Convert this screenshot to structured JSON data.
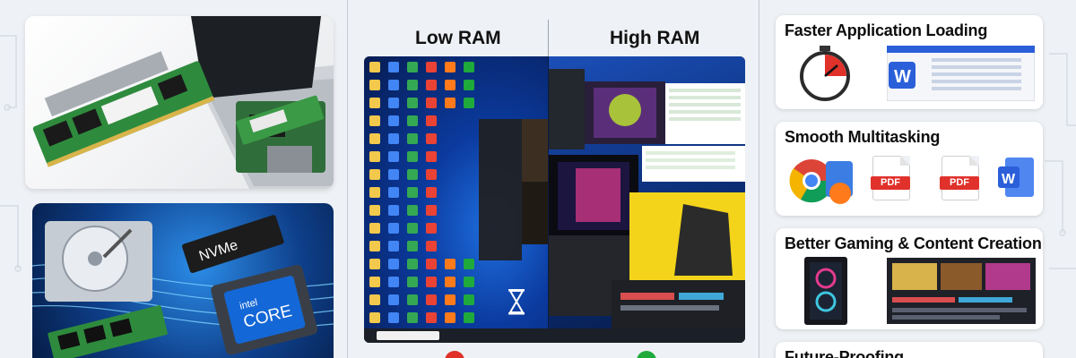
{
  "comparison": {
    "low_label": "Low RAM",
    "high_label": "High RAM"
  },
  "benefits": [
    {
      "title": "Faster Application Loading"
    },
    {
      "title": "Smooth Multitasking"
    },
    {
      "title": "Better Gaming & Content Creation"
    },
    {
      "title": "Future-Proofing"
    }
  ],
  "hardware": {
    "ssd_label": "NVMe",
    "cpu_brand": "intel",
    "cpu_model": "CORE"
  },
  "file_badges": {
    "pdf_1": "PDF",
    "pdf_2": "PDF",
    "word_letter": "W"
  },
  "colors": {
    "low_status": "#e0312b",
    "high_status": "#1faa3c",
    "word_blue": "#2b5fd9",
    "pdf_red": "#e0312b"
  },
  "icons": [
    "timer-icon",
    "word-icon",
    "chrome-icon",
    "pdf-icon",
    "hourglass-icon",
    "pc-tower-icon"
  ]
}
